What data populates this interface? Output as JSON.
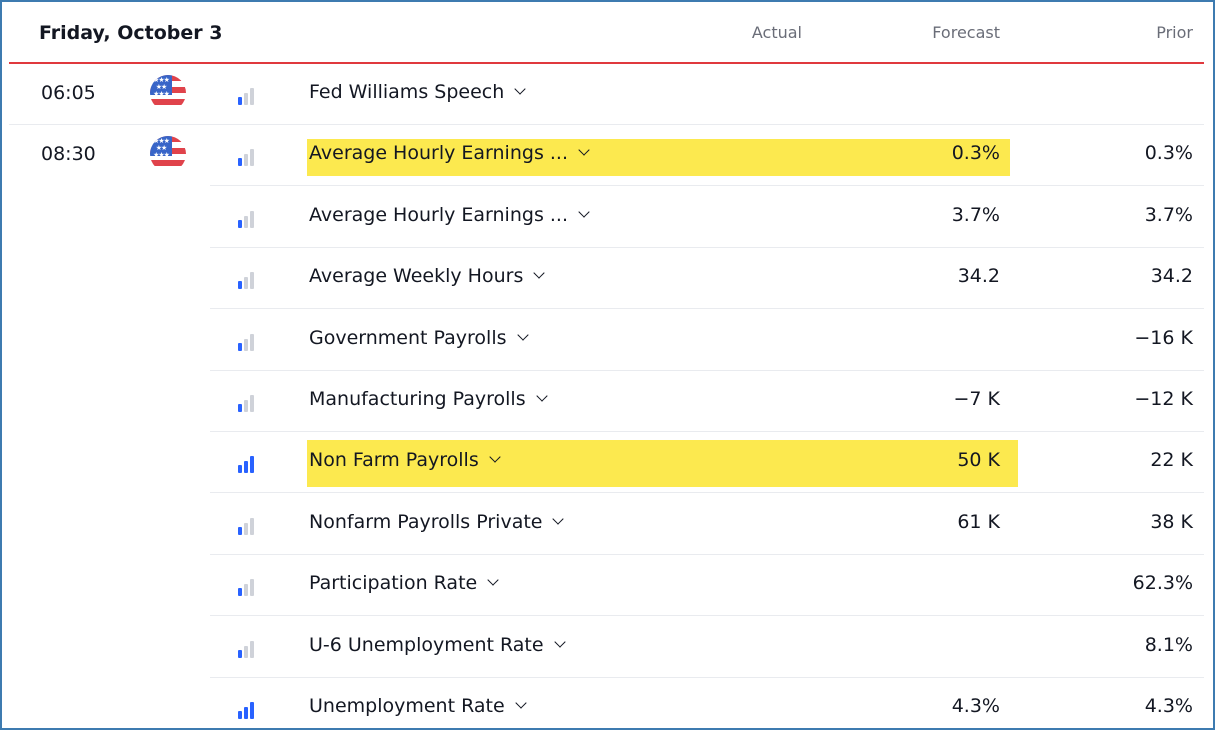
{
  "header": {
    "date": "Friday, October 3",
    "col_actual": "Actual",
    "col_forecast": "Forecast",
    "col_prior": "Prior"
  },
  "events": [
    {
      "time": "06:05",
      "flag": "us-flag-icon",
      "importance": 1,
      "name": "Fed Williams Speech",
      "forecast": "",
      "prior": "",
      "highlighted": false
    },
    {
      "time": "08:30",
      "flag": "us-flag-icon",
      "importance": 1,
      "name": "Average Hourly Earnings ...",
      "forecast": "0.3%",
      "prior": "0.3%",
      "highlighted": true
    },
    {
      "time": "",
      "importance": 1,
      "name": "Average Hourly Earnings ...",
      "forecast": "3.7%",
      "prior": "3.7%",
      "highlighted": false
    },
    {
      "time": "",
      "importance": 0,
      "name": "Average Weekly Hours",
      "forecast": "34.2",
      "prior": "34.2",
      "highlighted": false
    },
    {
      "time": "",
      "importance": 0,
      "name": "Government Payrolls",
      "forecast": "",
      "prior": "−16 K",
      "highlighted": false
    },
    {
      "time": "",
      "importance": 0,
      "name": "Manufacturing Payrolls",
      "forecast": "−7 K",
      "prior": "−12 K",
      "highlighted": false
    },
    {
      "time": "",
      "importance": 3,
      "name": "Non Farm Payrolls",
      "forecast": "50 K",
      "prior": "22 K",
      "highlighted": true
    },
    {
      "time": "",
      "importance": 0,
      "name": "Nonfarm Payrolls Private",
      "forecast": "61 K",
      "prior": "38 K",
      "highlighted": false
    },
    {
      "time": "",
      "importance": 1,
      "name": "Participation Rate",
      "forecast": "",
      "prior": "62.3%",
      "highlighted": false
    },
    {
      "time": "",
      "importance": 0,
      "name": "U-6 Unemployment Rate",
      "forecast": "",
      "prior": "8.1%",
      "highlighted": false
    },
    {
      "time": "",
      "importance": 3,
      "name": "Unemployment Rate",
      "forecast": "4.3%",
      "prior": "4.3%",
      "highlighted": false
    }
  ],
  "colors": {
    "highlight": "#fce94f",
    "importance_on": "#2962ff",
    "importance_off": "#cfd2d9",
    "header_rule": "#e0393e",
    "frame_border": "#3d7bb0"
  }
}
